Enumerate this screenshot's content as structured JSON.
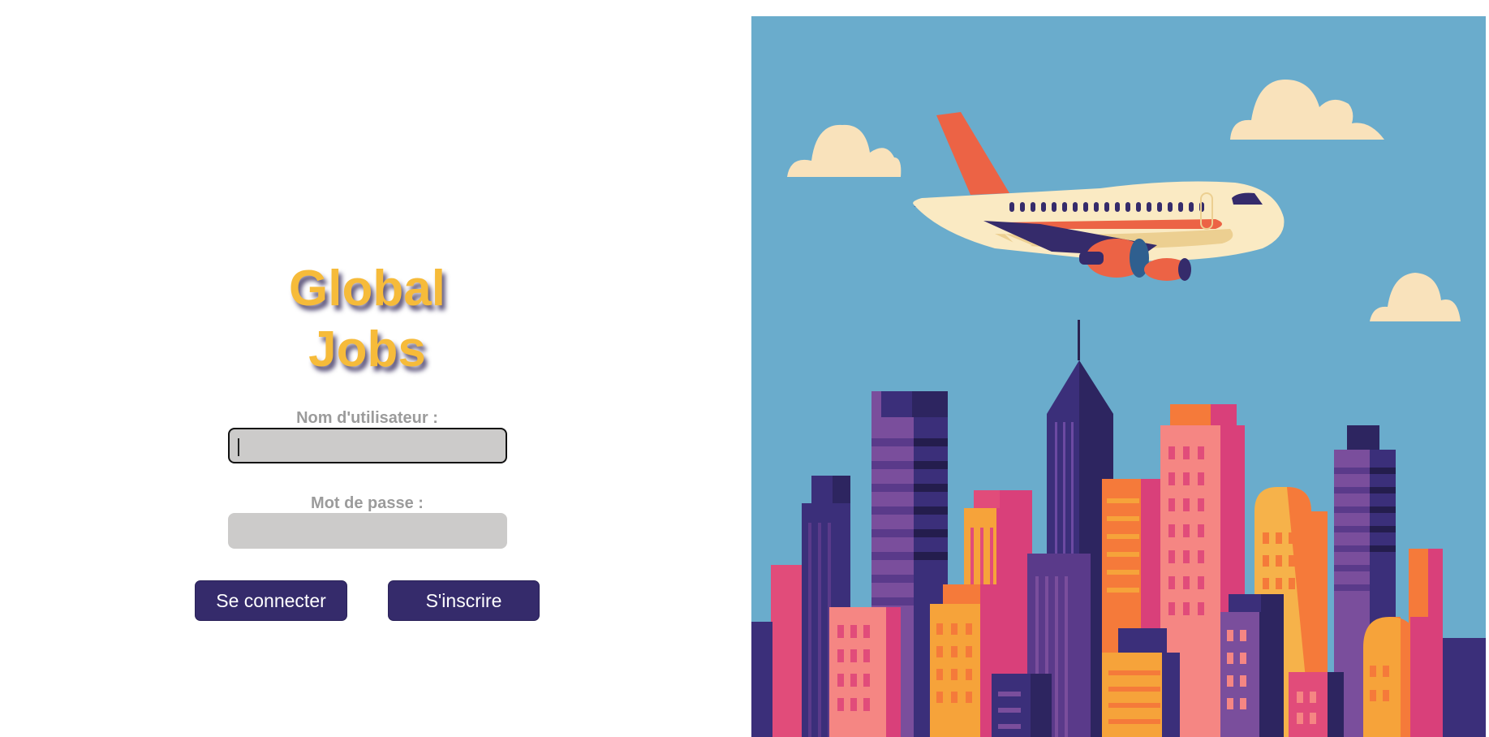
{
  "brand": {
    "line1": "Global",
    "line2": "Jobs"
  },
  "login_form": {
    "username_label": "Nom d'utilisateur :",
    "username_value": "",
    "password_label": "Mot de passe :",
    "password_value": "",
    "login_button": "Se connecter",
    "signup_button": "S'inscrire"
  },
  "illustration": {
    "icon": "airplane-over-city-illustration"
  },
  "colors": {
    "brand_yellow": "#f6bb3a",
    "button_purple": "#352b6b",
    "input_gray": "#cccbca",
    "label_gray": "#9b9b9b",
    "sky_blue": "#6aaccc"
  }
}
